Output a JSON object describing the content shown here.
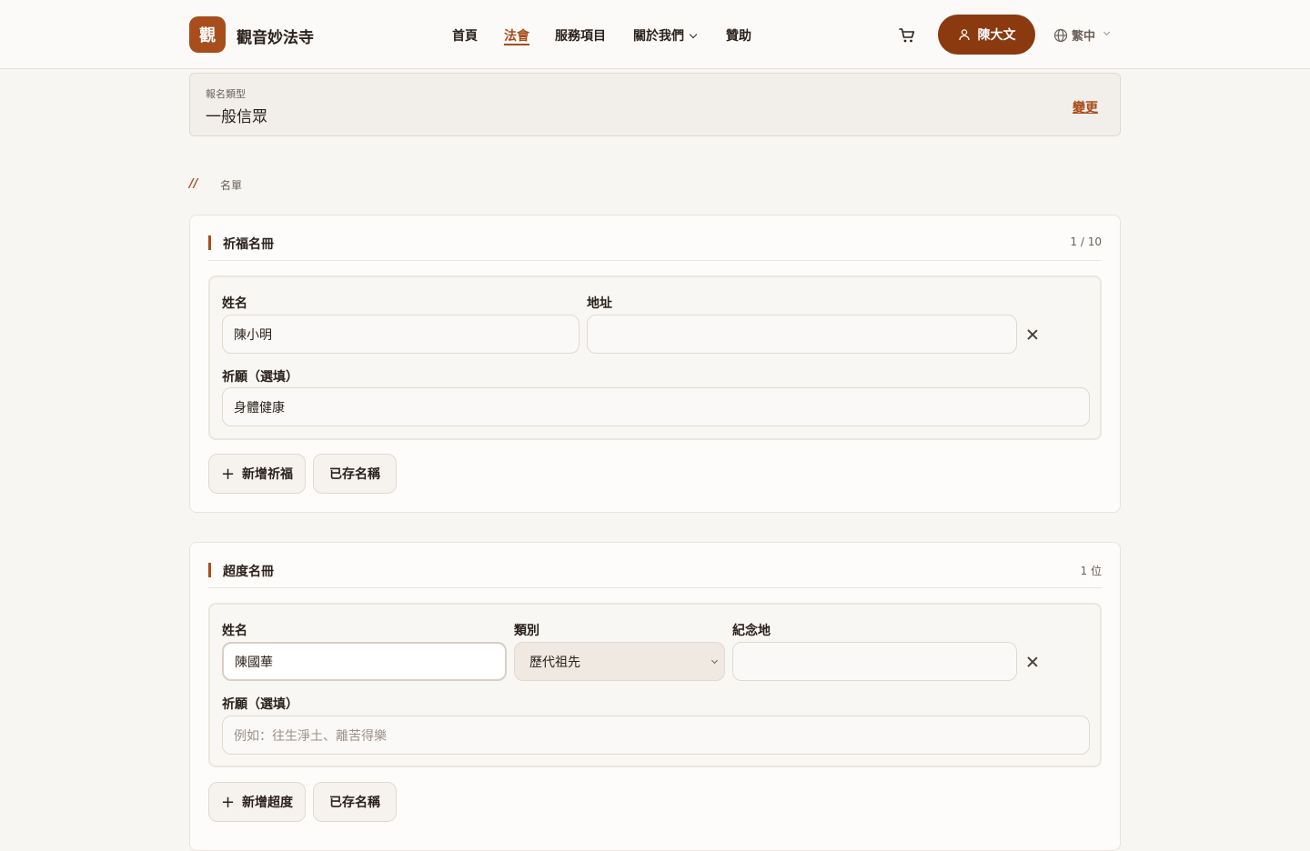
{
  "brand": {
    "logo_char": "觀",
    "name": "觀音妙法寺"
  },
  "nav": {
    "items": [
      "首頁",
      "法會",
      "服務項目",
      "關於我們",
      "贊助"
    ],
    "active": "法會"
  },
  "header": {
    "cart_icon": "cart-icon",
    "user_name": "陳大文",
    "lang": "繁中"
  },
  "registration": {
    "label": "報名類型",
    "value": "一般信眾",
    "change": "變更"
  },
  "breadcrumb": {
    "mark": "//",
    "current": "名單"
  },
  "blessing": {
    "title": "祈福名冊",
    "count": "1 / 10",
    "name_label": "姓名",
    "address_label": "地址",
    "wish_label": "祈願（選填）",
    "name_value": "陳小明",
    "address_value": "",
    "wish_value": "身體健康",
    "add_button": "新增祈福",
    "saved_button": "已存名稱"
  },
  "memorial": {
    "title": "超度名冊",
    "count": "1 位",
    "name_label": "姓名",
    "category_label": "類別",
    "place_label": "紀念地",
    "wish_label": "祈願（選填）",
    "name_value": "陳國華",
    "category_value": "歷代祖先",
    "place_value": "",
    "wish_placeholder": "例如：往生淨土、離苦得樂",
    "add_button": "新增超度",
    "saved_button": "已存名稱"
  },
  "colors": {
    "accent": "#a84d1c",
    "accent_dark": "#8b3a0f",
    "background": "#f8f6f3"
  }
}
